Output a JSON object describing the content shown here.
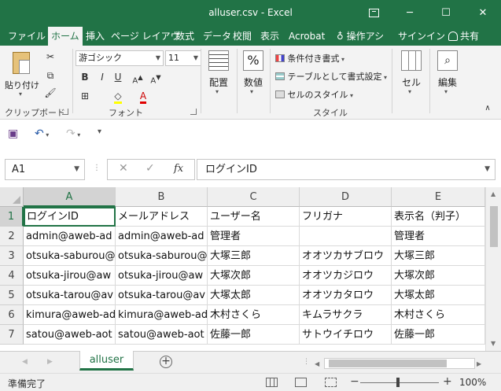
{
  "window": {
    "title": "alluser.csv - Excel"
  },
  "tabs": [
    {
      "label": "ファイル"
    },
    {
      "label": "ホーム"
    },
    {
      "label": "挿入"
    },
    {
      "label": "ページ レイアウ"
    },
    {
      "label": "数式"
    },
    {
      "label": "データ"
    },
    {
      "label": "校閲"
    },
    {
      "label": "表示"
    },
    {
      "label": "Acrobat"
    },
    {
      "label": "操作アシ"
    },
    {
      "label": "サインイン"
    },
    {
      "label": "共有"
    }
  ],
  "ribbon": {
    "clipboard": {
      "paste": "貼り付け",
      "group": "クリップボード"
    },
    "font": {
      "name": "游ゴシック",
      "size": "11",
      "bold": "B",
      "italic": "I",
      "underline": "U",
      "group": "フォント"
    },
    "alignment": {
      "label": "配置"
    },
    "number": {
      "label": "数値",
      "symbol": "%"
    },
    "styles": {
      "conditional": "条件付き書式",
      "table": "テーブルとして書式設定",
      "cell": "セルのスタイル",
      "group": "スタイル"
    },
    "cells": {
      "label": "セル"
    },
    "editing": {
      "label": "編集"
    }
  },
  "formula": {
    "name_box": "A1",
    "fx": "fx",
    "value": "ログインID"
  },
  "columns": [
    "A",
    "B",
    "C",
    "D",
    "E"
  ],
  "rows": [
    {
      "num": "1",
      "cells": [
        "ログインID",
        "メールアドレス",
        "ユーザー名",
        "フリガナ",
        "表示名（判子）"
      ]
    },
    {
      "num": "2",
      "cells": [
        "admin@aweb-ad",
        "admin@aweb-ad",
        "管理者",
        "",
        "管理者"
      ]
    },
    {
      "num": "3",
      "cells": [
        "otsuka-saburou@",
        "otsuka-saburou@",
        "大塚三郎",
        "オオツカサブロウ",
        "大塚三郎"
      ]
    },
    {
      "num": "4",
      "cells": [
        "otsuka-jirou@aw",
        "otsuka-jirou@aw",
        "大塚次郎",
        "オオツカジロウ",
        "大塚次郎"
      ]
    },
    {
      "num": "5",
      "cells": [
        "otsuka-tarou@av",
        "otsuka-tarou@av",
        "大塚太郎",
        "オオツカタロウ",
        "大塚太郎"
      ]
    },
    {
      "num": "6",
      "cells": [
        "kimura@aweb-ad",
        "kimura@aweb-ad",
        "木村さくら",
        "キムラサクラ",
        "木村さくら"
      ]
    },
    {
      "num": "7",
      "cells": [
        "satou@aweb-aot",
        "satou@aweb-aot",
        "佐藤一郎",
        "サトウイチロウ",
        "佐藤一郎"
      ]
    }
  ],
  "sheet": {
    "tab": "alluser",
    "add": "+"
  },
  "status": {
    "ready": "準備完了",
    "zoom": "100%"
  },
  "colors": {
    "accent": "#217346"
  }
}
